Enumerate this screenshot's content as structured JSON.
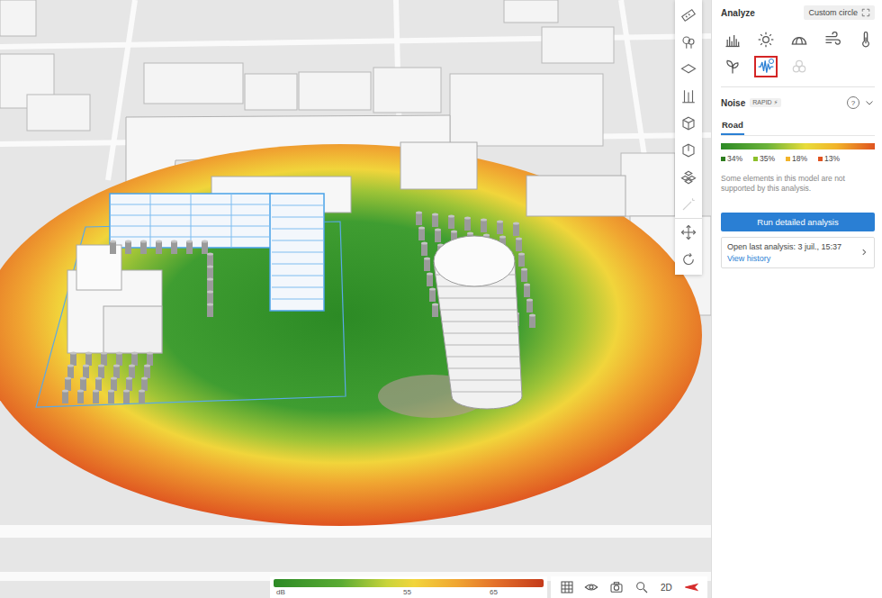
{
  "panel": {
    "title": "Analyze",
    "scope_button": "Custom circle"
  },
  "analysis_types": [
    {
      "kind": "bars",
      "selected": false,
      "disabled": false
    },
    {
      "kind": "sun",
      "selected": false,
      "disabled": false
    },
    {
      "kind": "dome",
      "selected": false,
      "disabled": false
    },
    {
      "kind": "wind",
      "selected": false,
      "disabled": false
    },
    {
      "kind": "thermometer",
      "selected": false,
      "disabled": false
    },
    {
      "kind": "plant",
      "selected": false,
      "disabled": false
    },
    {
      "kind": "noise",
      "selected": true,
      "disabled": false
    },
    {
      "kind": "cluster",
      "selected": false,
      "disabled": true
    }
  ],
  "analysis": {
    "title": "Noise",
    "badge": "RAPID",
    "badge_icon": "⚡",
    "help": "?",
    "expanded": true
  },
  "tabs": [
    {
      "label": "Road",
      "selected": true
    }
  ],
  "distribution": [
    {
      "share": "34%",
      "color": "#2e7d1f"
    },
    {
      "share": "35%",
      "color": "#8cbf2a"
    },
    {
      "share": "18%",
      "color": "#f2b42a"
    },
    {
      "share": "13%",
      "color": "#e0531f"
    }
  ],
  "note": "Some elements in this model are not supported by this analysis.",
  "run_button": "Run detailed analysis",
  "last_analysis": {
    "label": "Open last analysis:",
    "time": "3 juil., 15:37",
    "link": "View history"
  },
  "scale": {
    "ticks": [
      "dB",
      "55",
      "65"
    ]
  },
  "tools": [
    {
      "kind": "ruler",
      "disabled": false
    },
    {
      "kind": "trees",
      "disabled": false
    },
    {
      "kind": "layers",
      "disabled": false
    },
    {
      "kind": "measure",
      "disabled": false
    },
    {
      "kind": "cube",
      "disabled": false
    },
    {
      "kind": "box",
      "disabled": false
    },
    {
      "kind": "stack",
      "disabled": false
    },
    {
      "kind": "wand",
      "disabled": true
    },
    {
      "kind": "move",
      "disabled": false
    },
    {
      "kind": "rotate",
      "disabled": false
    }
  ],
  "view_controls": [
    {
      "kind": "grid",
      "label": ""
    },
    {
      "kind": "eye",
      "label": ""
    },
    {
      "kind": "camera",
      "label": ""
    },
    {
      "kind": "search",
      "label": ""
    },
    {
      "kind": "text",
      "label": "2D"
    },
    {
      "kind": "compass",
      "label": ""
    }
  ]
}
